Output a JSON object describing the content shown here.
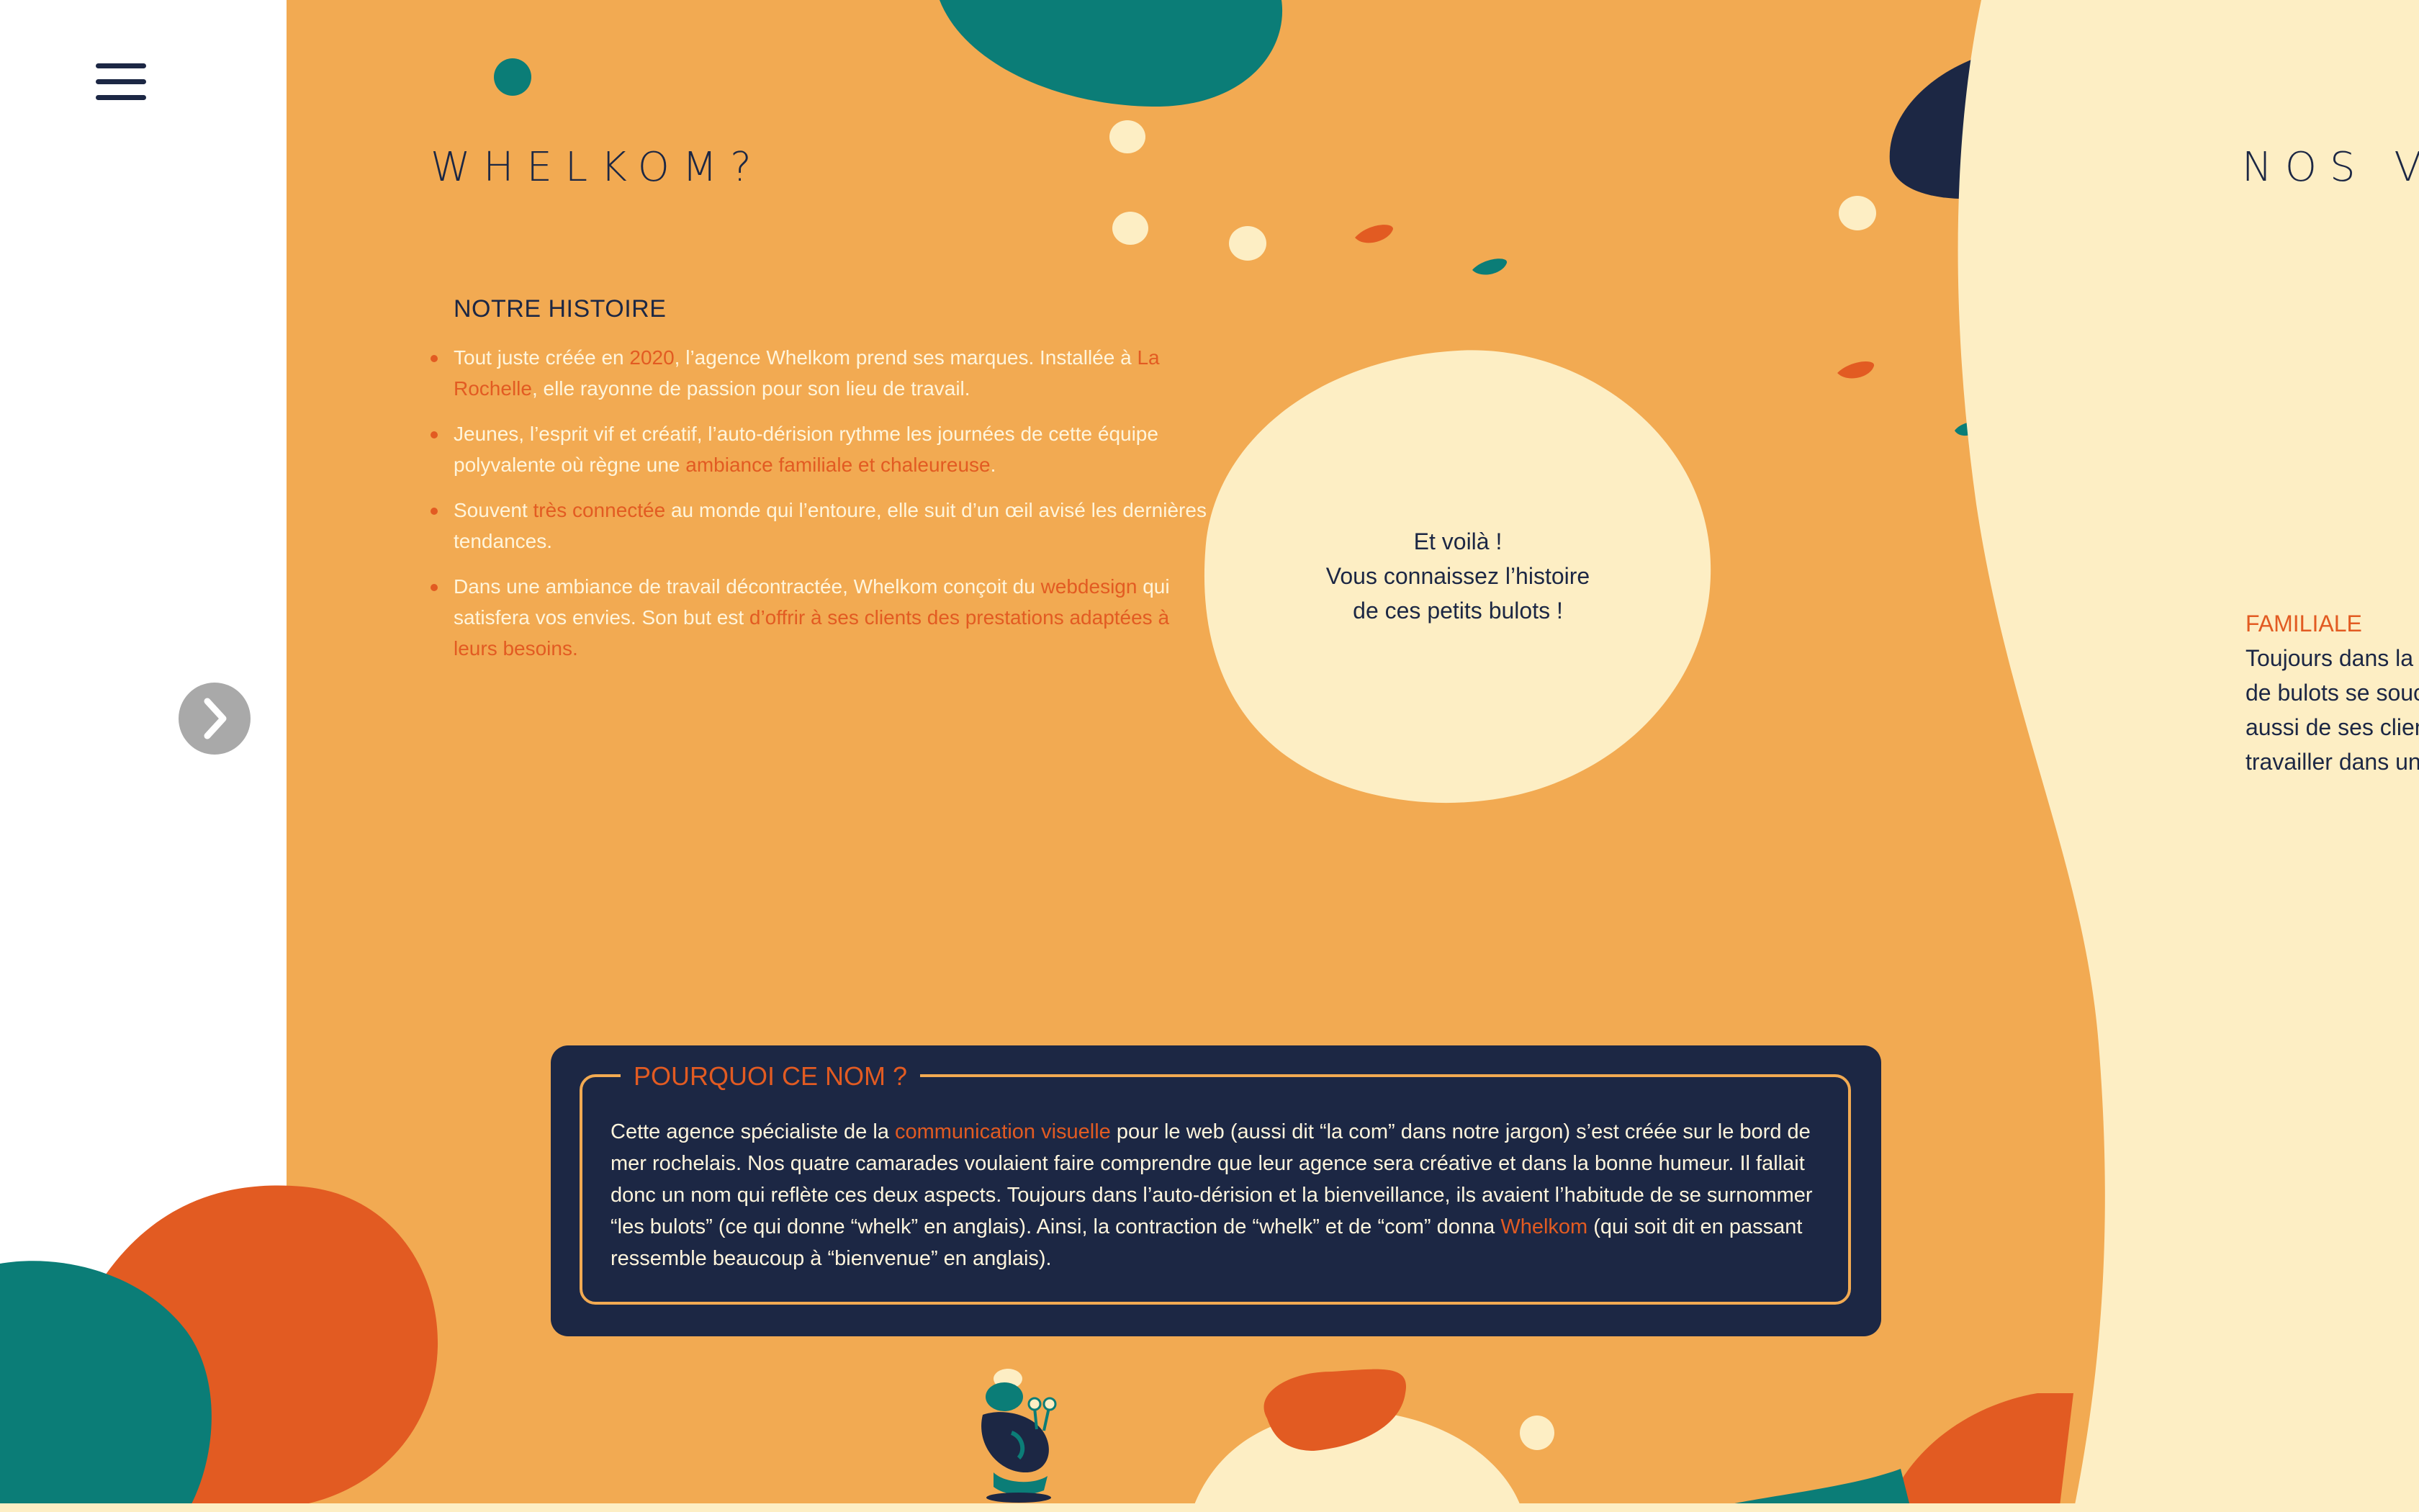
{
  "colors": {
    "orange_bg": "#f2aa52",
    "cream": "#fdeec4",
    "navy": "#1c2744",
    "teal": "#0b7d77",
    "accent_orange": "#e25b22",
    "gray_button": "#a9a9a9"
  },
  "nav": {
    "menu_icon": "hamburger-icon",
    "next_icon": "chevron-right-icon"
  },
  "sections": {
    "whelkom_title": "WHELKOM?",
    "next_section_title": "NOS V"
  },
  "histoire": {
    "title": "NOTRE HISTOIRE",
    "items": [
      {
        "parts": [
          {
            "text": "Tout juste créée en ",
            "hl": false
          },
          {
            "text": "2020",
            "hl": true
          },
          {
            "text": ", l’agence Whelkom prend ses marques. Installée à ",
            "hl": false
          },
          {
            "text": "La Rochelle",
            "hl": true
          },
          {
            "text": ", elle rayonne de passion pour son lieu de travail.",
            "hl": false
          }
        ]
      },
      {
        "parts": [
          {
            "text": "Jeunes, l’esprit vif et créatif, l’auto-dérision rythme les journées de cette équipe polyvalente où règne une ",
            "hl": false
          },
          {
            "text": "ambiance familiale et chaleureuse",
            "hl": true
          },
          {
            "text": ".",
            "hl": false
          }
        ]
      },
      {
        "parts": [
          {
            "text": "Souvent ",
            "hl": false
          },
          {
            "text": "très connectée",
            "hl": true
          },
          {
            "text": " au monde qui l’entoure, elle suit d’un œil avisé les dernières tendances.",
            "hl": false
          }
        ]
      },
      {
        "parts": [
          {
            "text": "Dans une ambiance de travail décontractée, Whelkom conçoit du ",
            "hl": false
          },
          {
            "text": "webdesign",
            "hl": true
          },
          {
            "text": " qui satisfera vos envies. Son but est ",
            "hl": false
          },
          {
            "text": "d’offrir à ses clients des prestations adaptées à leurs besoins.",
            "hl": true
          }
        ]
      }
    ]
  },
  "voila": {
    "line1": "Et voilà !",
    "line2": "Vous connaissez l’histoire",
    "line3": "de ces petits bulots !"
  },
  "pourquoi": {
    "title": "POURQUOI CE NOM ?",
    "parts": [
      {
        "text": "Cette agence spécialiste de la ",
        "hl": false
      },
      {
        "text": "communication visuelle",
        "hl": true
      },
      {
        "text": " pour le web (aussi dit “la com” dans notre jargon) s’est créée sur le bord de mer rochelais. Nos quatre camarades voulaient faire comprendre que leur agence sera créative et dans la bonne humeur. Il fallait donc un nom qui reflète ces deux aspects. Toujours dans l’auto-dérision et la bienveillance, ils avaient l’habitude de se surnommer “les bulots” (ce qui donne “whelk” en anglais). Ainsi, la contraction de “whelk” et de “com” donna ",
        "hl": false
      },
      {
        "text": "Whelkom",
        "hl": true
      },
      {
        "text": " (qui soit dit en passant ressemble beaucoup à “bienvenue” en anglais).",
        "hl": false
      }
    ]
  },
  "familiale": {
    "title": "FAMILIALE",
    "lines": [
      "Toujours dans la",
      "de bulots se souc",
      "aussi de ses clien",
      "travailler dans un"
    ]
  },
  "mascot": "snail-mascot-icon"
}
